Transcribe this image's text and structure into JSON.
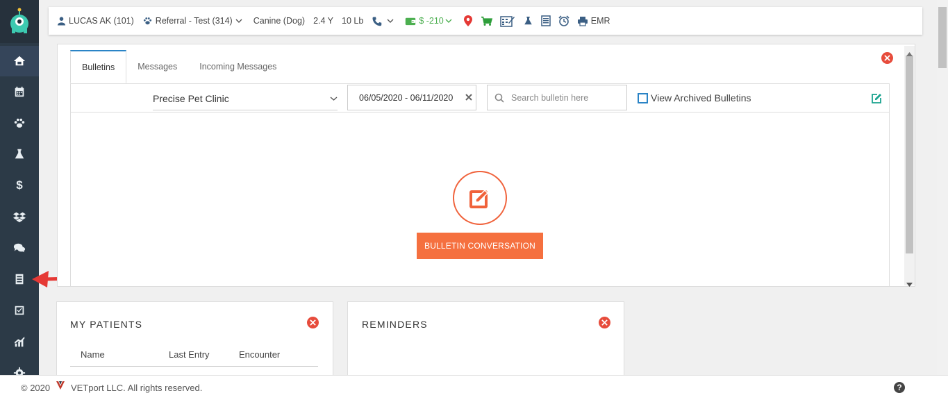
{
  "patient": {
    "name": "LUCAS AK (101)",
    "referral": "Referral - Test (314)",
    "species": "Canine (Dog)",
    "age": "2.4 Y",
    "weight": "10 Lb",
    "balance": "$ -210",
    "emr_label": "EMR"
  },
  "sidebar": {
    "items": [
      "home-icon",
      "calendar-icon",
      "paw-icon",
      "flask-icon",
      "dollar-icon",
      "dropbox-icon",
      "chat-icon",
      "document-icon",
      "checkbox-icon",
      "chart-icon",
      "gear-icon"
    ]
  },
  "bulletin": {
    "tabs": [
      "Bulletins",
      "Messages",
      "Incoming Messages"
    ],
    "active_tab": "Bulletins",
    "clinic": "Precise Pet Clinic",
    "date_range": "06/05/2020 - 06/11/2020",
    "search_placeholder": "Search bulletin here",
    "archived_label": "View Archived Bulletins",
    "button_label": "BULLETIN CONVERSATION"
  },
  "my_patients": {
    "title": "MY PATIENTS",
    "columns": [
      "Name",
      "Last Entry",
      "Encounter"
    ]
  },
  "reminders": {
    "title": "REMINDERS"
  },
  "footer": {
    "copyright_prefix": "© 2020",
    "copyright_suffix": "VETport LLC. All rights reserved."
  },
  "colors": {
    "sidebar": "#2c3a47",
    "accent_orange": "#f5703f",
    "accent_blue": "#2a84c6",
    "close_red": "#e74c3c",
    "balance_green": "#4caf50",
    "arrow_red": "#e53935"
  }
}
